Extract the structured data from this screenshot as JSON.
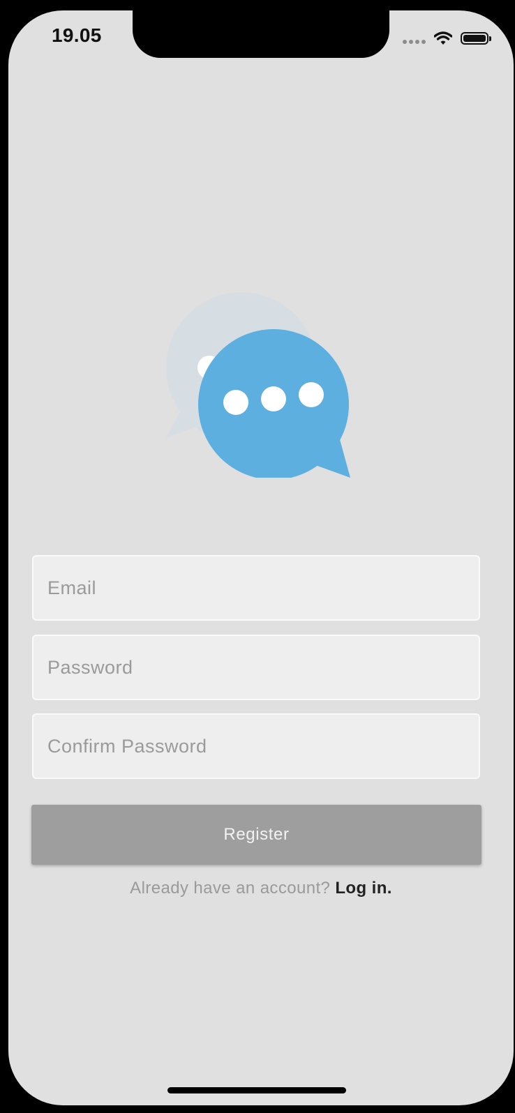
{
  "status_bar": {
    "time": "19.05",
    "signal_icon": "signal-dots-icon",
    "wifi_icon": "wifi-icon",
    "battery_icon": "battery-icon",
    "battery_level": 1.0
  },
  "logo": {
    "icon": "chat-bubbles-icon",
    "colors": {
      "front_bubble": "#5dafe0",
      "back_bubble": "#d6dde3",
      "dots": "#ffffff"
    }
  },
  "form": {
    "email": {
      "value": "",
      "placeholder": "Email"
    },
    "password": {
      "value": "",
      "placeholder": "Password"
    },
    "confirm_password": {
      "value": "",
      "placeholder": "Confirm Password"
    }
  },
  "register_button": {
    "label": "Register",
    "color": "#9e9e9e"
  },
  "login_prompt": {
    "text": "Already have an account?",
    "link_label": "Log in."
  },
  "colors": {
    "background": "#e0e0e0",
    "field_background": "#eeeeee"
  }
}
